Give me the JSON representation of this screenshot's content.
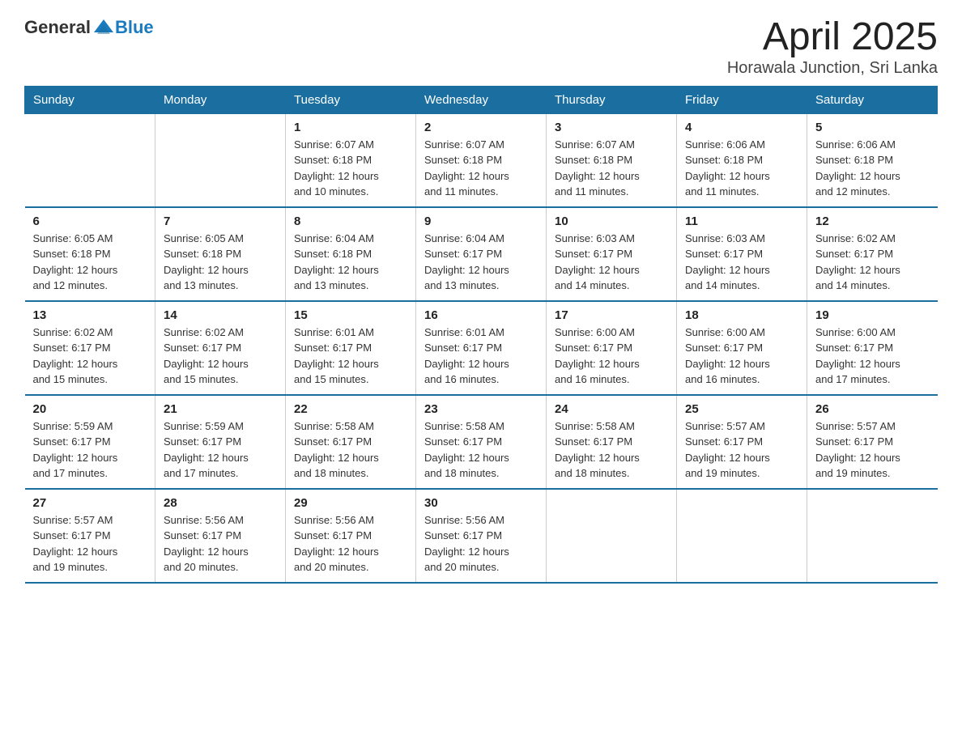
{
  "header": {
    "logo_general": "General",
    "logo_blue": "Blue",
    "title": "April 2025",
    "subtitle": "Horawala Junction, Sri Lanka"
  },
  "days_of_week": [
    "Sunday",
    "Monday",
    "Tuesday",
    "Wednesday",
    "Thursday",
    "Friday",
    "Saturday"
  ],
  "weeks": [
    [
      {
        "day": "",
        "info": ""
      },
      {
        "day": "",
        "info": ""
      },
      {
        "day": "1",
        "info": "Sunrise: 6:07 AM\nSunset: 6:18 PM\nDaylight: 12 hours\nand 10 minutes."
      },
      {
        "day": "2",
        "info": "Sunrise: 6:07 AM\nSunset: 6:18 PM\nDaylight: 12 hours\nand 11 minutes."
      },
      {
        "day": "3",
        "info": "Sunrise: 6:07 AM\nSunset: 6:18 PM\nDaylight: 12 hours\nand 11 minutes."
      },
      {
        "day": "4",
        "info": "Sunrise: 6:06 AM\nSunset: 6:18 PM\nDaylight: 12 hours\nand 11 minutes."
      },
      {
        "day": "5",
        "info": "Sunrise: 6:06 AM\nSunset: 6:18 PM\nDaylight: 12 hours\nand 12 minutes."
      }
    ],
    [
      {
        "day": "6",
        "info": "Sunrise: 6:05 AM\nSunset: 6:18 PM\nDaylight: 12 hours\nand 12 minutes."
      },
      {
        "day": "7",
        "info": "Sunrise: 6:05 AM\nSunset: 6:18 PM\nDaylight: 12 hours\nand 13 minutes."
      },
      {
        "day": "8",
        "info": "Sunrise: 6:04 AM\nSunset: 6:18 PM\nDaylight: 12 hours\nand 13 minutes."
      },
      {
        "day": "9",
        "info": "Sunrise: 6:04 AM\nSunset: 6:17 PM\nDaylight: 12 hours\nand 13 minutes."
      },
      {
        "day": "10",
        "info": "Sunrise: 6:03 AM\nSunset: 6:17 PM\nDaylight: 12 hours\nand 14 minutes."
      },
      {
        "day": "11",
        "info": "Sunrise: 6:03 AM\nSunset: 6:17 PM\nDaylight: 12 hours\nand 14 minutes."
      },
      {
        "day": "12",
        "info": "Sunrise: 6:02 AM\nSunset: 6:17 PM\nDaylight: 12 hours\nand 14 minutes."
      }
    ],
    [
      {
        "day": "13",
        "info": "Sunrise: 6:02 AM\nSunset: 6:17 PM\nDaylight: 12 hours\nand 15 minutes."
      },
      {
        "day": "14",
        "info": "Sunrise: 6:02 AM\nSunset: 6:17 PM\nDaylight: 12 hours\nand 15 minutes."
      },
      {
        "day": "15",
        "info": "Sunrise: 6:01 AM\nSunset: 6:17 PM\nDaylight: 12 hours\nand 15 minutes."
      },
      {
        "day": "16",
        "info": "Sunrise: 6:01 AM\nSunset: 6:17 PM\nDaylight: 12 hours\nand 16 minutes."
      },
      {
        "day": "17",
        "info": "Sunrise: 6:00 AM\nSunset: 6:17 PM\nDaylight: 12 hours\nand 16 minutes."
      },
      {
        "day": "18",
        "info": "Sunrise: 6:00 AM\nSunset: 6:17 PM\nDaylight: 12 hours\nand 16 minutes."
      },
      {
        "day": "19",
        "info": "Sunrise: 6:00 AM\nSunset: 6:17 PM\nDaylight: 12 hours\nand 17 minutes."
      }
    ],
    [
      {
        "day": "20",
        "info": "Sunrise: 5:59 AM\nSunset: 6:17 PM\nDaylight: 12 hours\nand 17 minutes."
      },
      {
        "day": "21",
        "info": "Sunrise: 5:59 AM\nSunset: 6:17 PM\nDaylight: 12 hours\nand 17 minutes."
      },
      {
        "day": "22",
        "info": "Sunrise: 5:58 AM\nSunset: 6:17 PM\nDaylight: 12 hours\nand 18 minutes."
      },
      {
        "day": "23",
        "info": "Sunrise: 5:58 AM\nSunset: 6:17 PM\nDaylight: 12 hours\nand 18 minutes."
      },
      {
        "day": "24",
        "info": "Sunrise: 5:58 AM\nSunset: 6:17 PM\nDaylight: 12 hours\nand 18 minutes."
      },
      {
        "day": "25",
        "info": "Sunrise: 5:57 AM\nSunset: 6:17 PM\nDaylight: 12 hours\nand 19 minutes."
      },
      {
        "day": "26",
        "info": "Sunrise: 5:57 AM\nSunset: 6:17 PM\nDaylight: 12 hours\nand 19 minutes."
      }
    ],
    [
      {
        "day": "27",
        "info": "Sunrise: 5:57 AM\nSunset: 6:17 PM\nDaylight: 12 hours\nand 19 minutes."
      },
      {
        "day": "28",
        "info": "Sunrise: 5:56 AM\nSunset: 6:17 PM\nDaylight: 12 hours\nand 20 minutes."
      },
      {
        "day": "29",
        "info": "Sunrise: 5:56 AM\nSunset: 6:17 PM\nDaylight: 12 hours\nand 20 minutes."
      },
      {
        "day": "30",
        "info": "Sunrise: 5:56 AM\nSunset: 6:17 PM\nDaylight: 12 hours\nand 20 minutes."
      },
      {
        "day": "",
        "info": ""
      },
      {
        "day": "",
        "info": ""
      },
      {
        "day": "",
        "info": ""
      }
    ]
  ]
}
